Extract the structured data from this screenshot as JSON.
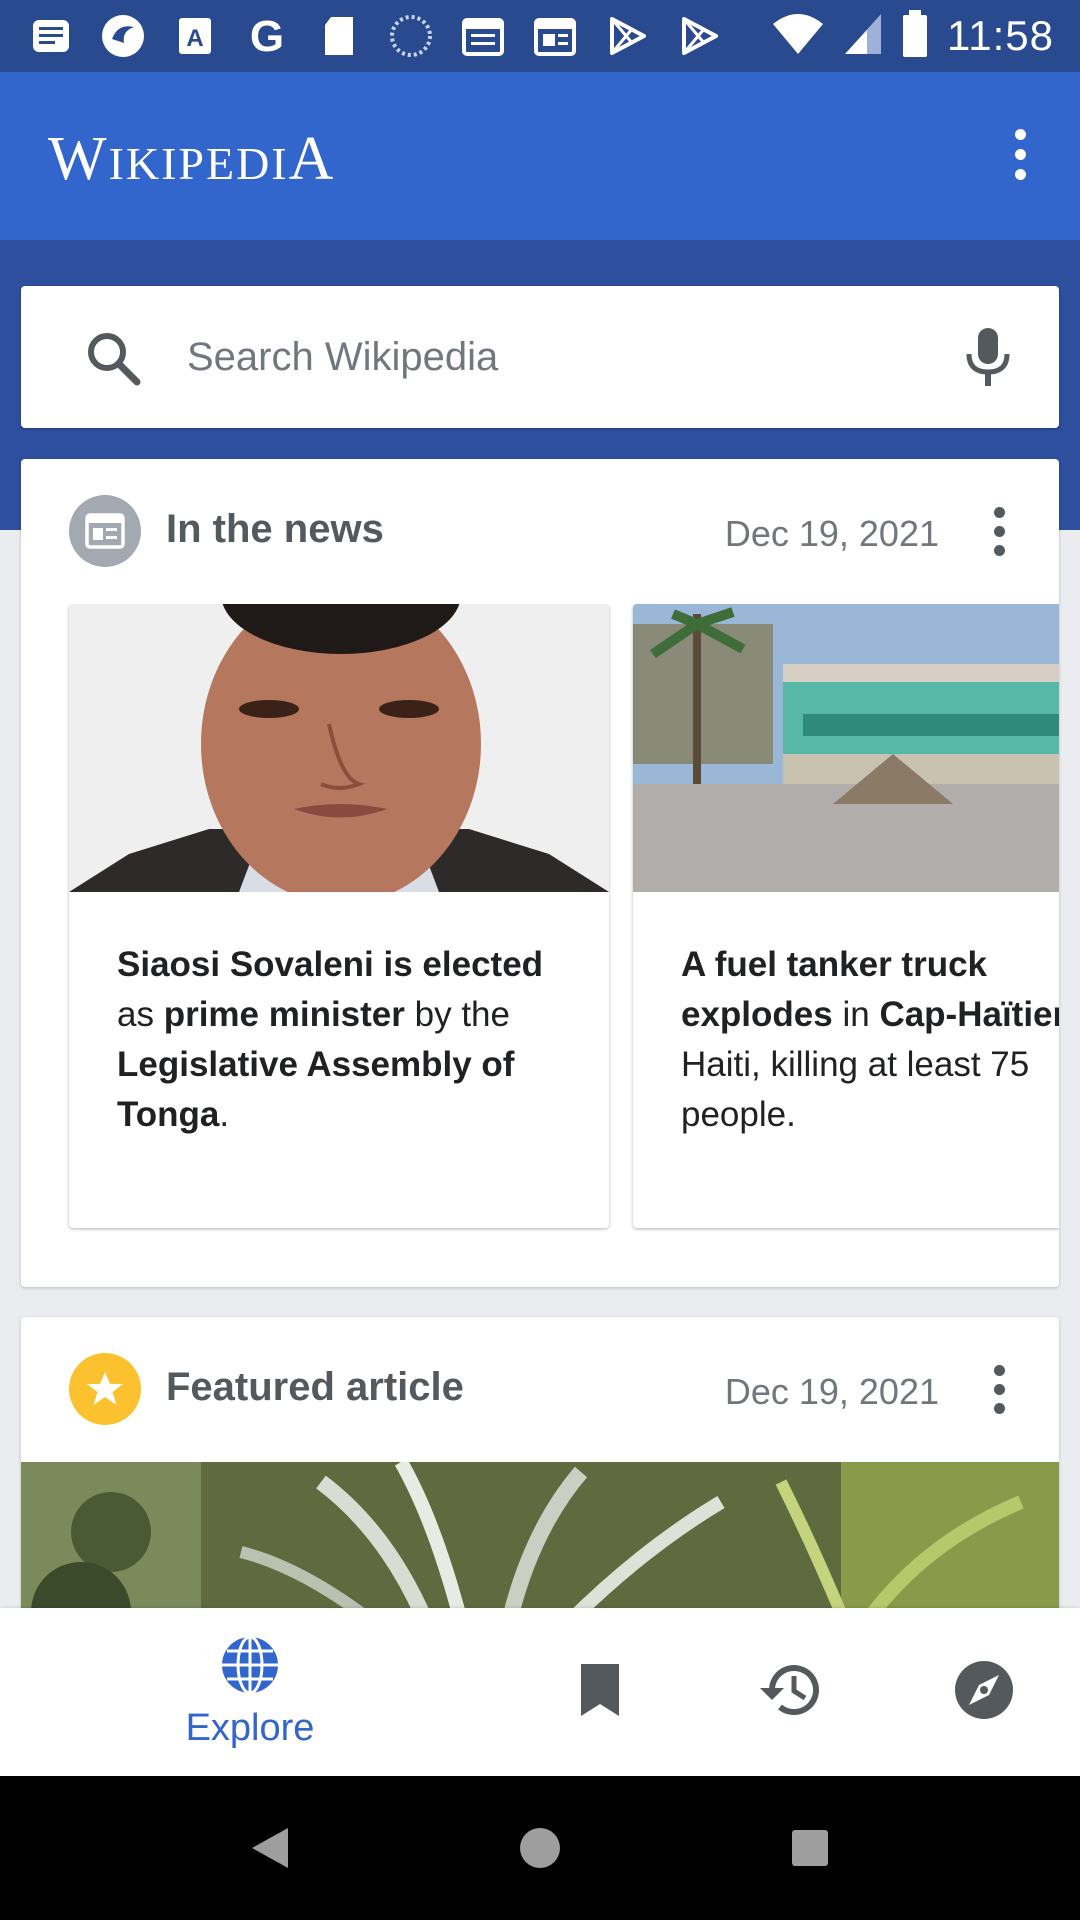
{
  "status_bar": {
    "time": "11:58",
    "icons": [
      "news-icon",
      "app-icon",
      "text-icon",
      "google-icon",
      "sd-card-icon",
      "loading-icon",
      "calendar-icon",
      "newspaper-icon",
      "play-store-icon",
      "play-store-icon",
      "wifi-icon",
      "signal-icon",
      "battery-icon"
    ]
  },
  "app_bar": {
    "logo": "WIKIPEDIA",
    "logo_parts": [
      "W",
      "IKIPEDI",
      "A"
    ]
  },
  "search": {
    "placeholder": "Search Wikipedia"
  },
  "cards": {
    "news": {
      "title": "In the news",
      "date": "Dec 19, 2021",
      "items": [
        {
          "segments": [
            {
              "text": "Siaosi Sovaleni is elected",
              "bold": true
            },
            {
              "text": " as ",
              "bold": false
            },
            {
              "text": "prime minister",
              "bold": true
            },
            {
              "text": " by the ",
              "bold": false
            },
            {
              "text": "Legislative Assembly of Tonga",
              "bold": true
            },
            {
              "text": ".",
              "bold": false
            }
          ]
        },
        {
          "segments": [
            {
              "text": "A fuel tanker truck explodes",
              "bold": true
            },
            {
              "text": " in ",
              "bold": false
            },
            {
              "text": "Cap-Haïtien",
              "bold": true
            },
            {
              "text": ", Haiti, killing at least 75 people.",
              "bold": false
            }
          ]
        }
      ]
    },
    "featured": {
      "title": "Featured article",
      "date": "Dec 19, 2021"
    }
  },
  "bottom_nav": {
    "explore_label": "Explore",
    "items": [
      "explore",
      "saved",
      "history",
      "nearby"
    ]
  },
  "colors": {
    "accent": "#3366cc",
    "status_bar": "#2a4a8f",
    "featured_star": "#fcc12e"
  }
}
